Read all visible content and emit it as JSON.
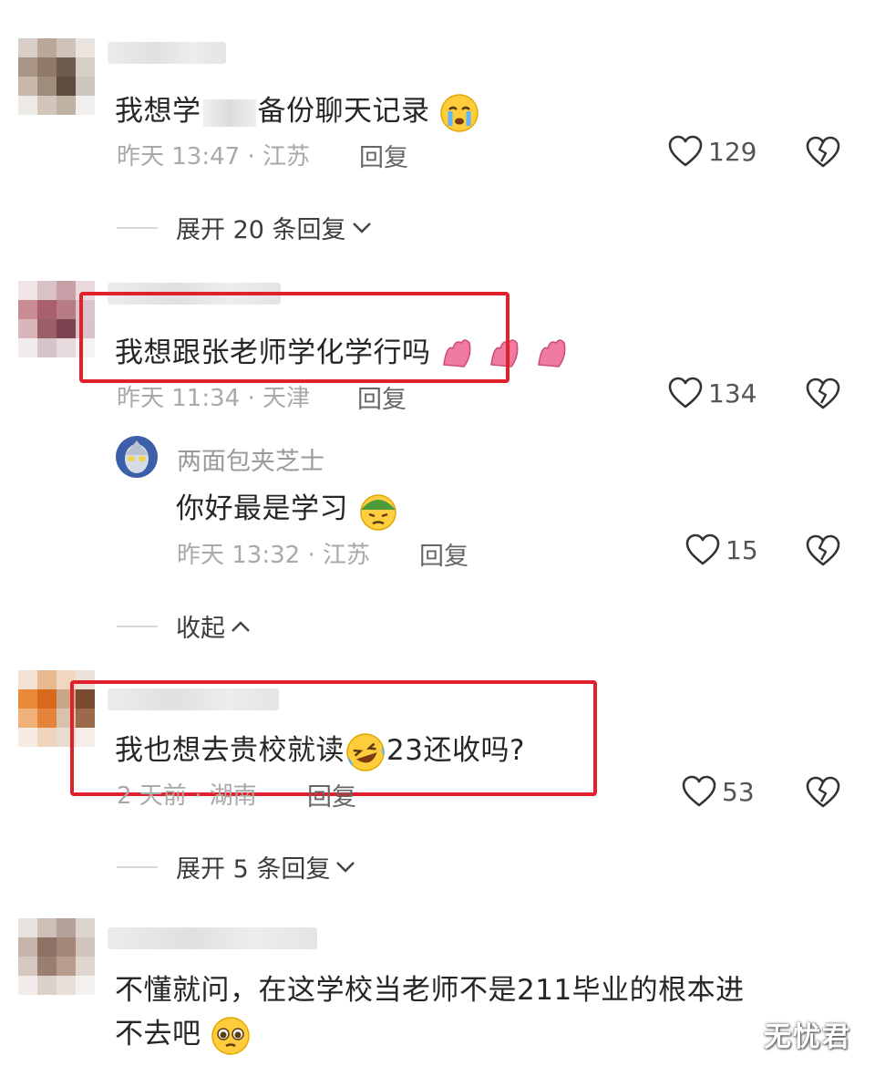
{
  "comments": [
    {
      "text_before": "我想学",
      "text_after": "备份聊天记录",
      "emoji": "crying-face-emoji",
      "meta": "昨天 13:47 · 江苏",
      "reply": "回复",
      "likes": "129",
      "expand": "展开 20 条回复"
    },
    {
      "text": "我想跟张老师学化学行吗",
      "emoji": "applause-hands-emoji",
      "meta": "昨天 11:34 · 天津",
      "reply": "回复",
      "likes": "134",
      "sub_reply": {
        "author": "两面包夹芝士",
        "text": "你好最是学习",
        "emoji": "helmet-face-emoji",
        "meta": "昨天 13:32 · 江苏",
        "reply": "回复",
        "likes": "15"
      },
      "collapse": "收起"
    },
    {
      "text": "我也想去贵校就读",
      "text_after": "23还收吗?",
      "emoji": "laughing-tears-emoji",
      "meta": "2 天前 · 湖南",
      "reply": "回复",
      "likes": "53",
      "expand": "展开 5 条回复"
    },
    {
      "text_line1": "不懂就问，在这学校当老师不是211毕业的根本进",
      "text_line2": "不去吧",
      "emoji": "pleading-face-emoji"
    }
  ],
  "watermark": "无忧君",
  "colors": {
    "highlight_box": "#e0202a",
    "meta": "#a9a9a9"
  }
}
